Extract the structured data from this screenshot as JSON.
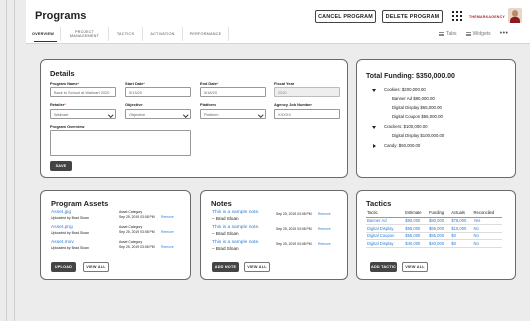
{
  "header": {
    "title": "Programs",
    "cancel_label": "CANCEL PROGRAM",
    "delete_label": "DELETE PROGRAM",
    "brand_text": "THEMARKAGENCY"
  },
  "tabs": [
    {
      "label": "OVERVIEW",
      "active": true
    },
    {
      "label": "PROJECT MANAGEMENT",
      "active": false
    },
    {
      "label": "TACTICS",
      "active": false
    },
    {
      "label": "ACTIVATION",
      "active": false
    },
    {
      "label": "PERFORMANCE",
      "active": false
    }
  ],
  "view_controls": {
    "tabs_label": "Tabs",
    "widgets_label": "Widgets",
    "more": "•••"
  },
  "details": {
    "title": "Details",
    "program_name_label": "Program Name",
    "program_name_value": "Back to School at Walmart 2020",
    "start_date_label": "Start Date",
    "start_date_value": "5/13/20",
    "end_date_label": "End Date",
    "end_date_value": "5/18/20",
    "fiscal_year_label": "Fiscal Year",
    "fiscal_year_value": "2020",
    "retailer_label": "Retailer",
    "retailer_value": "Walmart",
    "objective_label": "Objective",
    "objective_value": "Objective",
    "platform_label": "Platform",
    "platform_value": "Platform",
    "agency_label": "Agency Job Number",
    "agency_value": "XXXXX",
    "overview_label": "Program Overview",
    "save_label": "SAVE"
  },
  "funding": {
    "title": "Total Funding: $350,000.00",
    "groups": [
      {
        "label": "Cookies: $200,000.00",
        "expanded": true,
        "children": [
          "Banner Ad  $80,000.00",
          "Digital Display  $65,000.00",
          "Digital Coupon  $55,000.00"
        ]
      },
      {
        "label": "Crackers: $100,000.00",
        "expanded": true,
        "children": [
          "Digital Display  $100,000.00"
        ]
      },
      {
        "label": "Candy: $50,000.00",
        "expanded": false,
        "children": []
      }
    ]
  },
  "assets": {
    "title": "Program Assets",
    "items": [
      {
        "name": "Asset.jpg",
        "uploaded_by": "Uploaded by Brad Sloan",
        "category": "Asset Category",
        "date": "Sep 25, 2019 03:08 PM",
        "remove": "Remove"
      },
      {
        "name": "Asset.png",
        "uploaded_by": "Uploaded by Brad Sloan",
        "category": "Asset Category",
        "date": "Sep 25, 2019 03:08 PM",
        "remove": "Remove"
      },
      {
        "name": "Asset.mov",
        "uploaded_by": "Uploaded by Brad Sloan",
        "category": "Asset Category",
        "date": "Sep 25, 2019 03:08 PM",
        "remove": "Remove"
      }
    ],
    "upload_label": "UPLOAD",
    "view_all_label": "VIEW ALL"
  },
  "notes": {
    "title": "Notes",
    "items": [
      {
        "text": "This is a sample note.",
        "author": "– Brad Sloan",
        "date": "Sep 25, 2019 03:08 PM",
        "remove": "Remove"
      },
      {
        "text": "This is a sample note.",
        "author": "– Brad Sloan",
        "date": "Sep 25, 2019 03:08 PM",
        "remove": "Remove"
      },
      {
        "text": "This is a sample note.",
        "author": "– Brad Sloan",
        "date": "Sep 25, 2019 03:08 PM",
        "remove": "Remove"
      }
    ],
    "add_label": "ADD NOTE",
    "view_all_label": "VIEW ALL"
  },
  "tactics": {
    "title": "Tactics",
    "columns": [
      "Tactic",
      "Estimate",
      "Funding",
      "Actuals",
      "Reconciled"
    ],
    "rows": [
      [
        "Banner Ad",
        "$80,000",
        "$80,000",
        "$78,000",
        "Yes"
      ],
      [
        "Digital Display",
        "$65,000",
        "$65,000",
        "$10,000",
        "No"
      ],
      [
        "Digital Coupon",
        "$55,000",
        "$55,000",
        "$0",
        "No"
      ],
      [
        "Digital Display",
        "$40,000",
        "$40,000",
        "$0",
        "No"
      ]
    ],
    "add_label": "ADD TACTIC",
    "view_all_label": "VIEW ALL"
  },
  "colors": {
    "link": "#2f7dd1",
    "required": "#c0392b",
    "dark_button": "#444444",
    "brand": "#b8222a"
  }
}
